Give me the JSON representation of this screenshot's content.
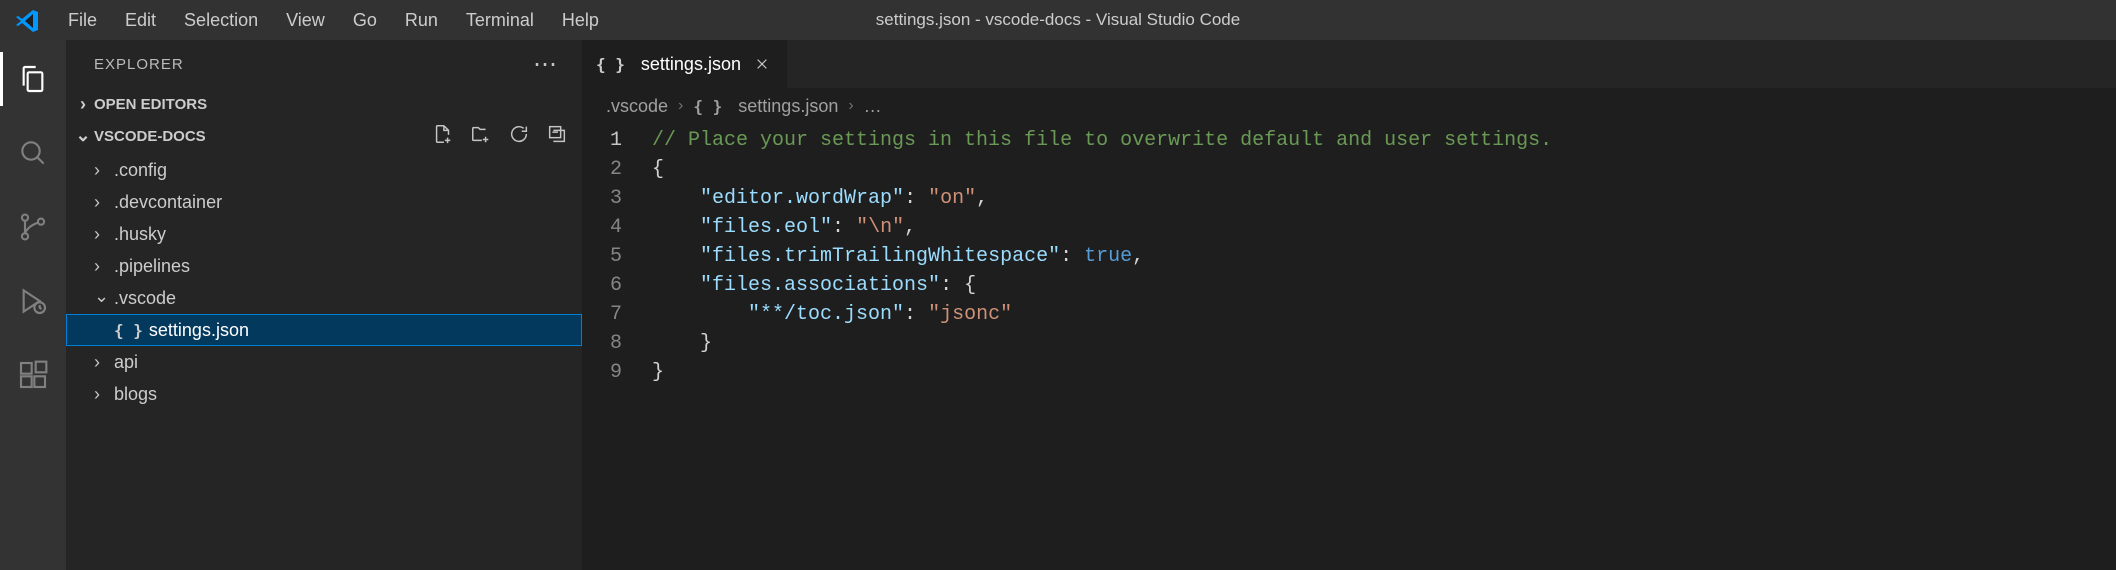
{
  "window_title": "settings.json - vscode-docs - Visual Studio Code",
  "menu": {
    "file": "File",
    "edit": "Edit",
    "selection": "Selection",
    "view": "View",
    "go": "Go",
    "run": "Run",
    "terminal": "Terminal",
    "help": "Help"
  },
  "sidebar": {
    "title": "EXPLORER",
    "open_editors": "OPEN EDITORS",
    "workspace": "VSCODE-DOCS",
    "tree": {
      "config": ".config",
      "devcontainer": ".devcontainer",
      "husky": ".husky",
      "pipelines": ".pipelines",
      "vscode": ".vscode",
      "settings": "settings.json",
      "api": "api",
      "blogs": "blogs"
    }
  },
  "tab": {
    "label": "settings.json"
  },
  "breadcrumb": {
    "folder": ".vscode",
    "file": "settings.json",
    "more": "…"
  },
  "editor": {
    "lines": [
      "1",
      "2",
      "3",
      "4",
      "5",
      "6",
      "7",
      "8",
      "9"
    ],
    "comment": "// Place your settings in this file to overwrite default and user settings.",
    "k_wordWrap": "\"editor.wordWrap\"",
    "v_wordWrap": "\"on\"",
    "k_eol": "\"files.eol\"",
    "v_eol": "\"\\n\"",
    "k_trim": "\"files.trimTrailingWhitespace\"",
    "v_trim": "true",
    "k_assoc": "\"files.associations\"",
    "k_toc": "\"**/toc.json\"",
    "v_toc": "\"jsonc\""
  }
}
